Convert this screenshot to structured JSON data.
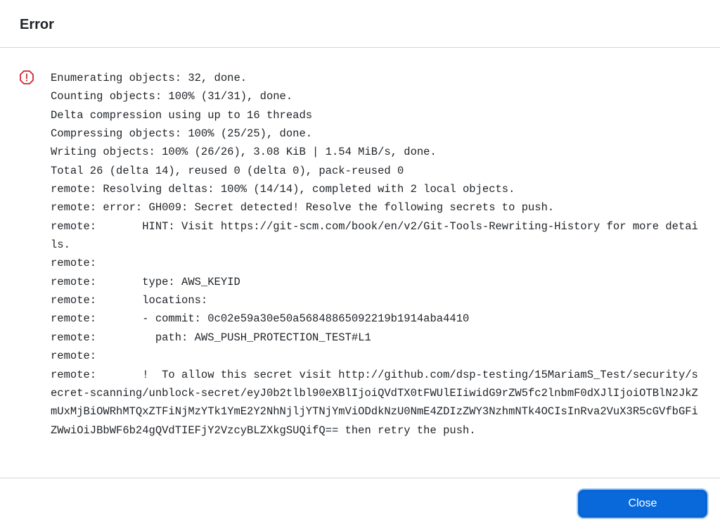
{
  "header": {
    "title": "Error"
  },
  "body": {
    "icon": "stop-alert-icon",
    "log": "Enumerating objects: 32, done.\nCounting objects: 100% (31/31), done.\nDelta compression using up to 16 threads\nCompressing objects: 100% (25/25), done.\nWriting objects: 100% (26/26), 3.08 KiB | 1.54 MiB/s, done.\nTotal 26 (delta 14), reused 0 (delta 0), pack-reused 0\nremote: Resolving deltas: 100% (14/14), completed with 2 local objects.\nremote: error: GH009: Secret detected! Resolve the following secrets to push.\nremote:       HINT: Visit https://git-scm.com/book/en/v2/Git-Tools-Rewriting-History for more details.\nremote:\nremote:       type: AWS_KEYID\nremote:       locations:\nremote:       - commit: 0c02e59a30e50a56848865092219b1914aba4410\nremote:         path: AWS_PUSH_PROTECTION_TEST#L1\nremote:\nremote:       !  To allow this secret visit http://github.com/dsp-testing/15MariamS_Test/security/secret-scanning/unblock-secret/eyJ0b2tlbl90eXBlIjoiQVdTX0tFWUlEIiwidG9rZW5fc2lnbmF0dXJlIjoiOTBlN2JkZmUxMjBiOWRhMTQxZTFiNjMzYTk1YmE2Y2NhNjljYTNjYmViODdkNzU0NmE4ZDIzZWY3NzhmNTk4OCIsInRva2VuX3R5cGVfbGFiZWwiOiJBbWF6b24gQVdTIEFjY2VzcyBLZXkgSUQifQ== then retry the push."
  },
  "footer": {
    "close_label": "Close"
  },
  "colors": {
    "danger": "#cf222e",
    "primary": "#0969da",
    "border": "#d0d7de"
  }
}
